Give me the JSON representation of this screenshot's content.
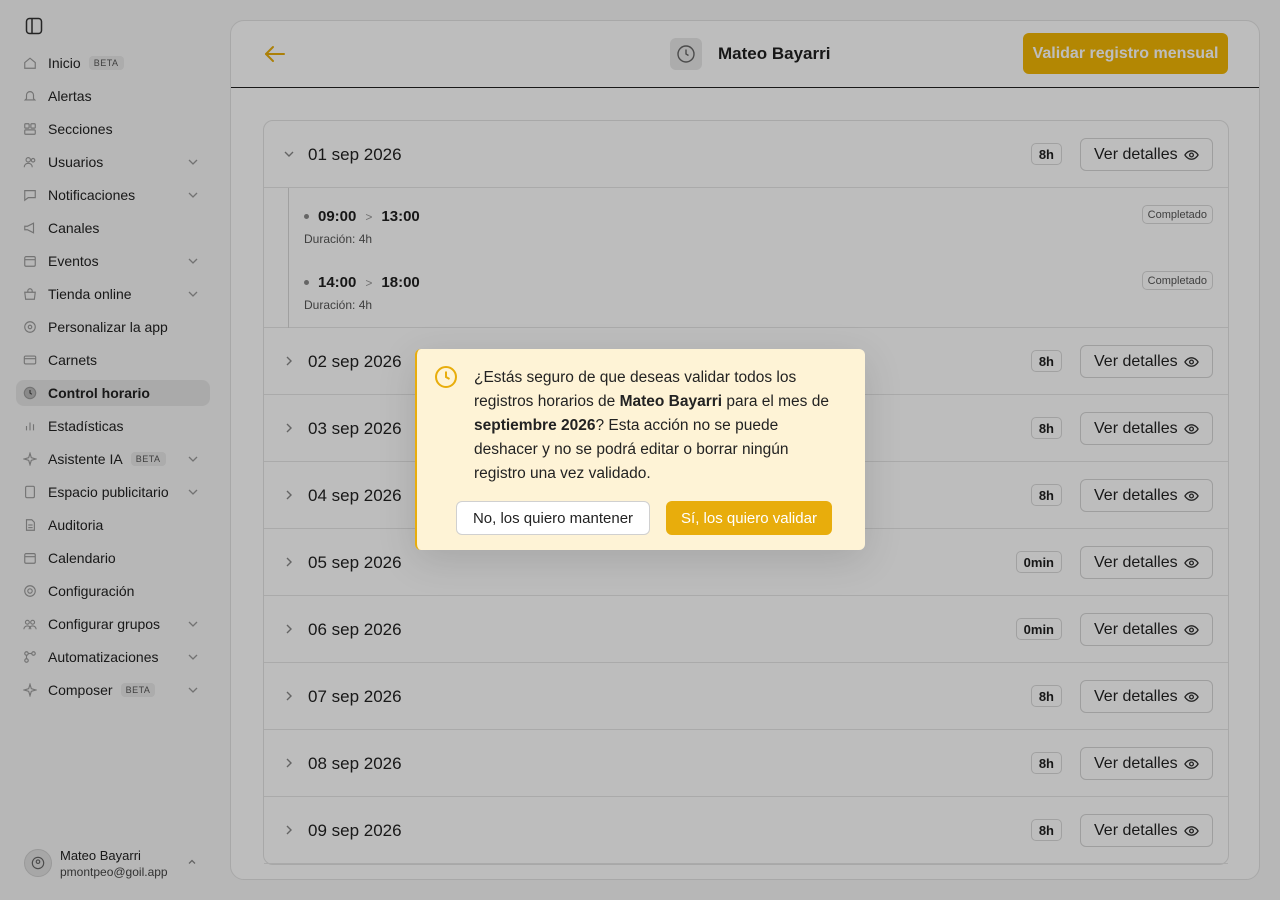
{
  "sidebar": {
    "items": [
      {
        "label": "Inicio",
        "icon": "home-icon",
        "badge": "BETA",
        "chevron": false,
        "active": false
      },
      {
        "label": "Alertas",
        "icon": "bell-icon",
        "badge": "",
        "chevron": false,
        "active": false
      },
      {
        "label": "Secciones",
        "icon": "sections-icon",
        "badge": "",
        "chevron": false,
        "active": false
      },
      {
        "label": "Usuarios",
        "icon": "users-icon",
        "badge": "",
        "chevron": true,
        "active": false
      },
      {
        "label": "Notificaciones",
        "icon": "message-icon",
        "badge": "",
        "chevron": true,
        "active": false
      },
      {
        "label": "Canales",
        "icon": "megaphone-icon",
        "badge": "",
        "chevron": false,
        "active": false
      },
      {
        "label": "Eventos",
        "icon": "calendar-icon",
        "badge": "",
        "chevron": true,
        "active": false
      },
      {
        "label": "Tienda online",
        "icon": "shop-icon",
        "badge": "",
        "chevron": true,
        "active": false
      },
      {
        "label": "Personalizar la app",
        "icon": "brush-icon",
        "badge": "",
        "chevron": false,
        "active": false
      },
      {
        "label": "Carnets",
        "icon": "card-icon",
        "badge": "",
        "chevron": false,
        "active": false
      },
      {
        "label": "Control horario",
        "icon": "clock-icon",
        "badge": "",
        "chevron": false,
        "active": true
      },
      {
        "label": "Estadísticas",
        "icon": "stats-icon",
        "badge": "",
        "chevron": false,
        "active": false
      },
      {
        "label": "Asistente IA",
        "icon": "sparkle-icon",
        "badge": "BETA",
        "chevron": true,
        "active": false
      },
      {
        "label": "Espacio publicitario",
        "icon": "ad-icon",
        "badge": "",
        "chevron": true,
        "active": false
      },
      {
        "label": "Auditoria",
        "icon": "audit-icon",
        "badge": "",
        "chevron": false,
        "active": false
      },
      {
        "label": "Calendario",
        "icon": "calendar-icon",
        "badge": "",
        "chevron": false,
        "active": false
      },
      {
        "label": "Configuración",
        "icon": "gear-icon",
        "badge": "",
        "chevron": false,
        "active": false
      },
      {
        "label": "Configurar grupos",
        "icon": "groups-icon",
        "badge": "",
        "chevron": true,
        "active": false
      },
      {
        "label": "Automatizaciones",
        "icon": "automation-icon",
        "badge": "",
        "chevron": true,
        "active": false
      },
      {
        "label": "Composer",
        "icon": "sparkle-icon",
        "badge": "BETA",
        "chevron": true,
        "active": false
      }
    ],
    "user": {
      "name": "Mateo Bayarri",
      "email": "pmontpeo@goil.app"
    }
  },
  "header": {
    "title": "Mateo Bayarri",
    "validate_label": "Validar registro mensual"
  },
  "days": [
    {
      "date": "01 sep 2026",
      "hours": "8h",
      "details": "Ver detalles",
      "expanded": true,
      "entries": [
        {
          "start": "09:00",
          "end": "13:00",
          "duration": "Duración: 4h",
          "status": "Completado"
        },
        {
          "start": "14:00",
          "end": "18:00",
          "duration": "Duración: 4h",
          "status": "Completado"
        }
      ]
    },
    {
      "date": "02 sep 2026",
      "hours": "8h",
      "details": "Ver detalles",
      "expanded": false,
      "entries": []
    },
    {
      "date": "03 sep 2026",
      "hours": "8h",
      "details": "Ver detalles",
      "expanded": false,
      "entries": []
    },
    {
      "date": "04 sep 2026",
      "hours": "8h",
      "details": "Ver detalles",
      "expanded": false,
      "entries": []
    },
    {
      "date": "05 sep 2026",
      "hours": "0min",
      "details": "Ver detalles",
      "expanded": false,
      "entries": []
    },
    {
      "date": "06 sep 2026",
      "hours": "0min",
      "details": "Ver detalles",
      "expanded": false,
      "entries": []
    },
    {
      "date": "07 sep 2026",
      "hours": "8h",
      "details": "Ver detalles",
      "expanded": false,
      "entries": []
    },
    {
      "date": "08 sep 2026",
      "hours": "8h",
      "details": "Ver detalles",
      "expanded": false,
      "entries": []
    },
    {
      "date": "09 sep 2026",
      "hours": "8h",
      "details": "Ver detalles",
      "expanded": false,
      "entries": []
    }
  ],
  "modal": {
    "message_1": "¿Estás seguro de que deseas validar todos los registros horarios de ",
    "name": "Mateo Bayarri",
    "message_2": " para el mes de ",
    "month": "septiembre 2026",
    "message_3": "? Esta acción no se puede deshacer y no se podrá editar o borrar ningún registro una vez validado.",
    "cancel_label": "No, los quiero mantener",
    "confirm_label": "Sí, los quiero validar"
  },
  "colors": {
    "accent": "#f2b705",
    "modal_bg": "#fef3d6"
  }
}
